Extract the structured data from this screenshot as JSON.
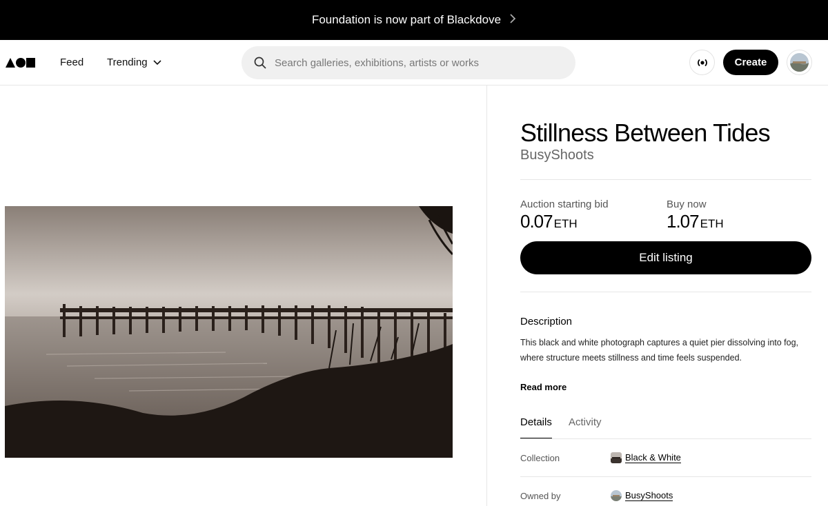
{
  "banner": {
    "text": "Foundation is now part of Blackdove",
    "icon": "chevron-right-icon"
  },
  "nav": {
    "logo": "foundation-logo",
    "feed_label": "Feed",
    "trending_label": "Trending",
    "search_placeholder": "Search galleries, exhibitions, artists or works",
    "create_label": "Create"
  },
  "artwork": {
    "title": "Stillness Between Tides",
    "artist": "BusyShoots",
    "image": "foggy-pier-photo"
  },
  "pricing": {
    "auction_label": "Auction starting bid",
    "auction_value": "0.07",
    "auction_unit": "ETH",
    "buy_label": "Buy now",
    "buy_value": "1.07",
    "buy_unit": "ETH",
    "edit_label": "Edit listing"
  },
  "description": {
    "heading": "Description",
    "text": "This black and white photograph captures a quiet pier dissolving into fog, where structure meets stillness and time feels suspended.",
    "read_more": "Read more"
  },
  "tabs": [
    {
      "label": "Details"
    },
    {
      "label": "Activity"
    }
  ],
  "details": [
    {
      "label": "Collection",
      "value": "Black & White"
    },
    {
      "label": "Owned by",
      "value": "BusyShoots"
    }
  ],
  "colors": {
    "background": "#ffffff",
    "primary": "#000000",
    "muted": "#666666",
    "divider": "#e6e6e6"
  }
}
